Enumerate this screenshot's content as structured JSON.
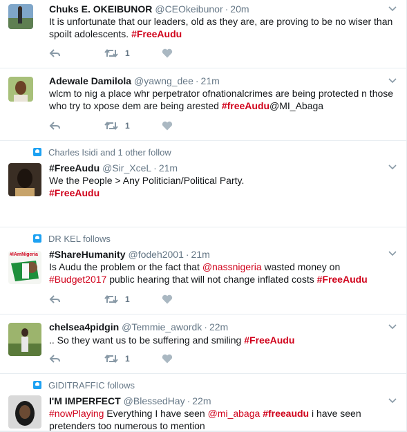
{
  "colors": {
    "hashtag": "#d0021b",
    "meta": "#657786",
    "accent": "#1da1f2"
  },
  "tweets": [
    {
      "context": "",
      "name": "Chuks E. OKEIBUNOR",
      "handle": "@CEOkeibunor",
      "dot": "·",
      "time": "20m",
      "text_a": "It is unfortunate that our leaders, old as they are, are proving to be no wiser than spoilt adolescents.  ",
      "tag_a": "#FreeAudu",
      "retweets": "1"
    },
    {
      "context": "",
      "name": "Adewale Damilola",
      "handle": "@yawng_dee",
      "dot": "·",
      "time": "21m",
      "text_a": "wlcm to nig a place whr perpetrator ofnationalcrimes are being protected n those who try to xpose dem are being arested ",
      "tag_a": "#freeAudu",
      "text_b": "@MI_Abaga",
      "retweets": "1"
    },
    {
      "context": "Charles Isidi and 1 other follow",
      "name": "#FreeAudu",
      "handle": "@Sir_XceL",
      "dot": "·",
      "time": "21m",
      "text_a": "We the People > Any Politician/Political Party.",
      "tag_a": "#FreeAudu"
    },
    {
      "context": "DR KEL follows",
      "name": "#ShareHumanity",
      "handle": "@fodeh2001",
      "dot": "·",
      "time": "21m",
      "text_a": "Is Audu the problem or the fact that ",
      "mention_a": "@nassnigeria",
      "text_b": " wasted money on ",
      "tag_a": "#Budget2017",
      "text_c": " public hearing that will not change inflated costs ",
      "tag_b": "#FreeAudu",
      "avatar_label": "#IAmNigeria",
      "retweets": "1"
    },
    {
      "context": "",
      "name": "chelsea4pidgin",
      "handle": "@Temmie_awordk",
      "dot": "·",
      "time": "22m",
      "text_a": ".. So they want us to be suffering and smiling ",
      "tag_a": "#FreeAudu",
      "retweets": "1"
    },
    {
      "context": "GIDITRAFFIC follows",
      "name": "I'M IMPERFECT",
      "handle": "@BlessedHay",
      "dot": "·",
      "time": "22m",
      "tag_a": "#nowPlaying",
      "text_a": " Everything I have seen ",
      "mention_a": "@mi_abaga",
      "text_b": " ",
      "tag_b": "#freeaudu",
      "text_c": " i have seen pretenders too numerous to mention"
    }
  ]
}
